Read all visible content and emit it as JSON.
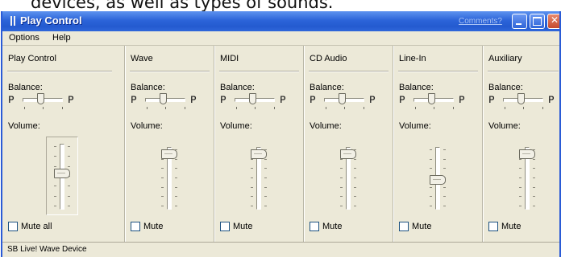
{
  "page_text": "devices, as well as types of sounds.",
  "window": {
    "title": "Play Control",
    "comments_link": "Comments?"
  },
  "menu": [
    "Options",
    "Help"
  ],
  "columns": [
    {
      "name": "Play Control",
      "balance_label": "Balance:",
      "volume_label": "Volume:",
      "mute_label": "Mute all",
      "volume_level": 0.55
    },
    {
      "name": "Wave",
      "balance_label": "Balance:",
      "volume_label": "Volume:",
      "mute_label": "Mute",
      "volume_level": 0.95
    },
    {
      "name": "MIDI",
      "balance_label": "Balance:",
      "volume_label": "Volume:",
      "mute_label": "Mute",
      "volume_level": 0.95
    },
    {
      "name": "CD Audio",
      "balance_label": "Balance:",
      "volume_label": "Volume:",
      "mute_label": "Mute",
      "volume_level": 0.95
    },
    {
      "name": "Line-In",
      "balance_label": "Balance:",
      "volume_label": "Volume:",
      "mute_label": "Mute",
      "volume_level": 0.45
    },
    {
      "name": "Auxiliary",
      "balance_label": "Balance:",
      "volume_label": "Volume:",
      "mute_label": "Mute",
      "volume_level": 0.95
    }
  ],
  "status": {
    "device": "SB Live! Wave Device"
  }
}
